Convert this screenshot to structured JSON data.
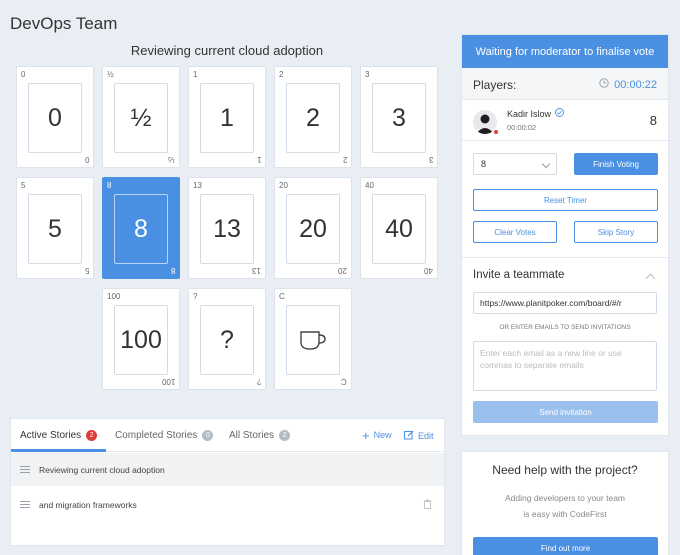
{
  "team_title": "DevOps Team",
  "current_story": "Reviewing current cloud adoption",
  "cards": [
    {
      "label": "0",
      "value": "0"
    },
    {
      "label": "½",
      "value": "½"
    },
    {
      "label": "1",
      "value": "1"
    },
    {
      "label": "2",
      "value": "2"
    },
    {
      "label": "3",
      "value": "3"
    },
    {
      "label": "5",
      "value": "5"
    },
    {
      "label": "8",
      "value": "8"
    },
    {
      "label": "13",
      "value": "13"
    },
    {
      "label": "20",
      "value": "20"
    },
    {
      "label": "40",
      "value": "40"
    },
    {
      "label": "100",
      "value": "100"
    },
    {
      "label": "?",
      "value": "?"
    },
    {
      "label": "C",
      "value": "coffee-cup-icon"
    }
  ],
  "selected_card": "8",
  "stories": {
    "tabs": [
      {
        "label": "Active Stories",
        "count": "2"
      },
      {
        "label": "Completed Stories",
        "count": "0"
      },
      {
        "label": "All Stories",
        "count": "2"
      }
    ],
    "new_label": "New",
    "edit_label": "Edit",
    "items": [
      {
        "title": "Reviewing current cloud adoption"
      },
      {
        "title": "and migration frameworks"
      }
    ]
  },
  "panel": {
    "status": "Waiting for moderator to finalise vote",
    "players_label": "Players:",
    "timer": "00:00:22",
    "player": {
      "name": "Kadir Islow",
      "time": "00:00:02",
      "vote": "8"
    },
    "vote_select_value": "8",
    "finish_voting": "Finish Voting",
    "reset_timer": "Reset Timer",
    "clear_votes": "Clear Votes",
    "skip_story": "Skip Story",
    "invite_title": "Invite a teammate",
    "invite_url": "https://www.planitpoker.com/board/#/r",
    "or_text": "OR ENTER EMAILS TO SEND INVITATIONS",
    "emails_placeholder": "Enter each email as a new line or use commas to separate emails",
    "send_invitation": "Send invitation"
  },
  "help": {
    "title": "Need help with the project?",
    "line1": "Adding developers to your team",
    "line2": "is easy with CodeFirst",
    "button": "Find out more"
  },
  "colors": {
    "accent": "#4a90e2",
    "badge_red": "#e03b3b",
    "background": "#e9eef4"
  }
}
